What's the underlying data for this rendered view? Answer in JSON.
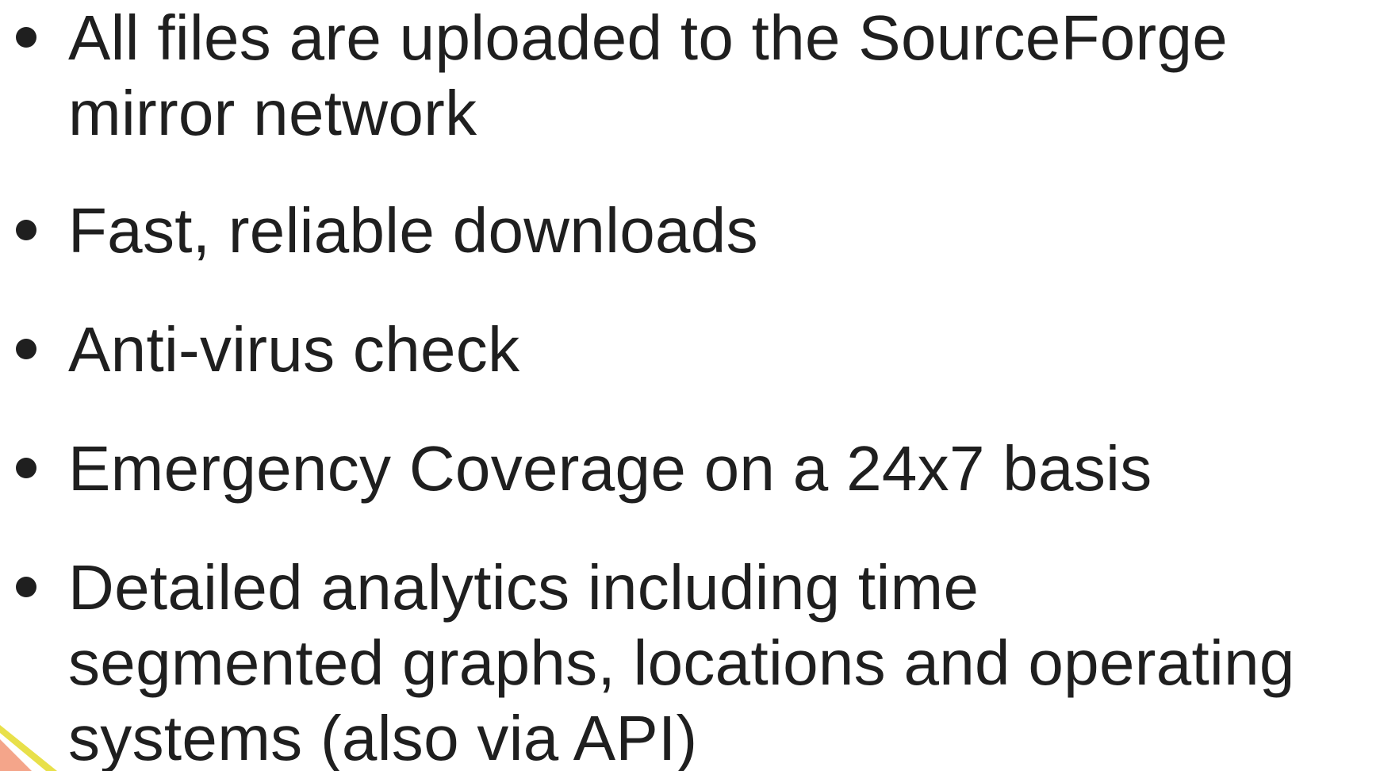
{
  "slide": {
    "bullets": [
      {
        "text": "All files are uploaded to the SourceForge\nmirror network"
      },
      {
        "text": "Fast, reliable downloads"
      },
      {
        "text": "Anti-virus check"
      },
      {
        "text": "Emergency Coverage on a 24x7 basis"
      },
      {
        "text": "Detailed analytics including time\nsegmented graphs, locations and operating\nsystems (also via API)"
      }
    ]
  },
  "colors": {
    "text": "#1f1f1f",
    "background": "#ffffff",
    "accent_yellow": "#e8e04a",
    "accent_salmon": "#f4a58a"
  }
}
